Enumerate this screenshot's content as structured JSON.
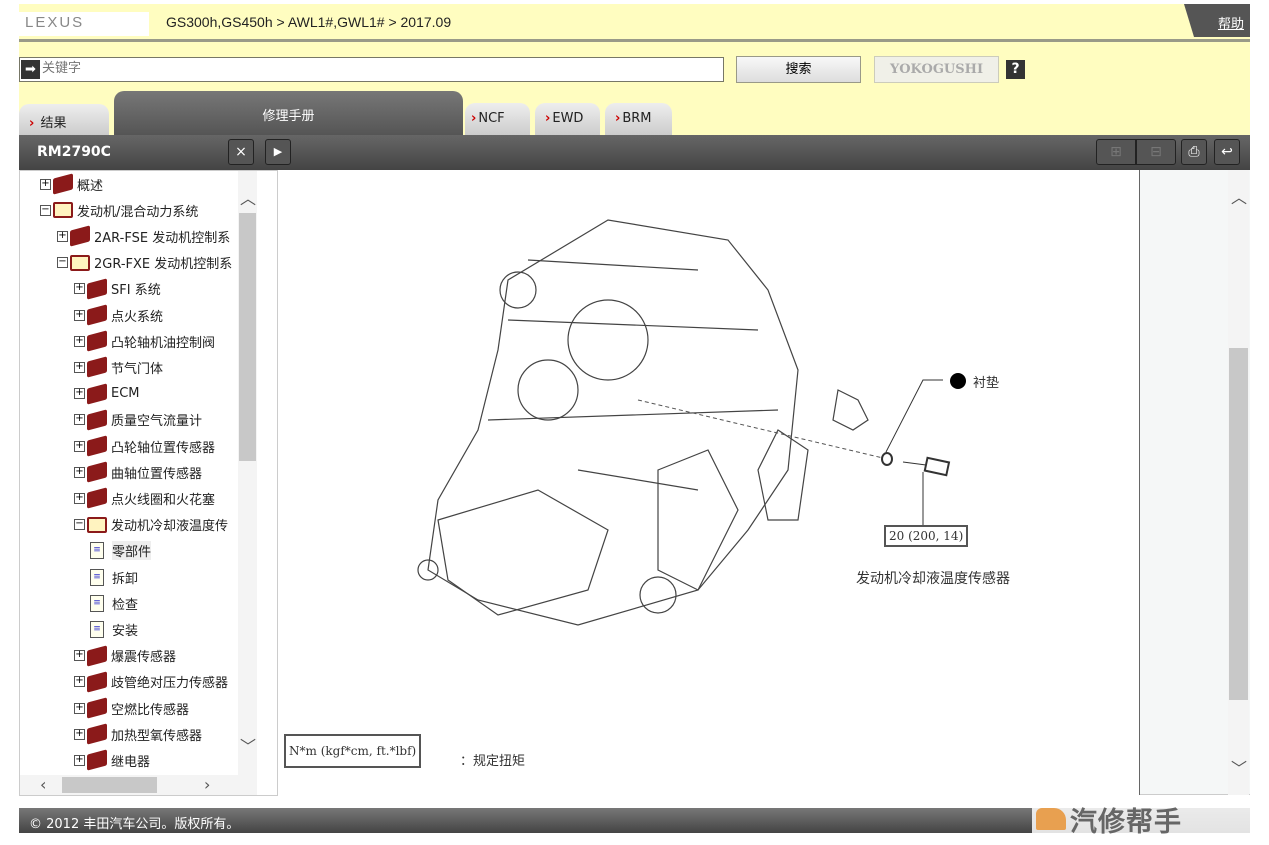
{
  "header": {
    "logo": "LEXUS",
    "breadcrumb": "GS300h,GS450h > AWL1#,GWL1# > 2017.09",
    "help": "帮助"
  },
  "search": {
    "placeholder": "关键字",
    "value": "",
    "search_btn": "搜索",
    "yokogushi_btn": "YOKOGUSHI",
    "help_icon": "?"
  },
  "tabs": [
    {
      "label": "结果"
    },
    {
      "label": "修理手册",
      "active": true
    },
    {
      "label": "NCF"
    },
    {
      "label": "EWD"
    },
    {
      "label": "BRM"
    }
  ],
  "toolbar": {
    "doc_id": "RM2790C",
    "close": "×",
    "expand": "▶",
    "zoom_in": "⊞",
    "zoom_out": "⊟",
    "print": "print-icon",
    "back": "back-icon"
  },
  "tree": [
    {
      "label": "概述",
      "level": 0,
      "type": "closed"
    },
    {
      "label": "发动机/混合动力系统",
      "level": 0,
      "type": "open"
    },
    {
      "label": "2AR-FSE 发动机控制系",
      "level": 1,
      "type": "closed"
    },
    {
      "label": "2GR-FXE 发动机控制系",
      "level": 1,
      "type": "open"
    },
    {
      "label": "SFI 系统",
      "level": 2,
      "type": "closed"
    },
    {
      "label": "点火系统",
      "level": 2,
      "type": "closed"
    },
    {
      "label": "凸轮轴机油控制阀",
      "level": 2,
      "type": "closed"
    },
    {
      "label": "节气门体",
      "level": 2,
      "type": "closed"
    },
    {
      "label": "ECM",
      "level": 2,
      "type": "closed"
    },
    {
      "label": "质量空气流量计",
      "level": 2,
      "type": "closed"
    },
    {
      "label": "凸轮轴位置传感器",
      "level": 2,
      "type": "closed"
    },
    {
      "label": "曲轴位置传感器",
      "level": 2,
      "type": "closed"
    },
    {
      "label": "点火线圈和火花塞",
      "level": 2,
      "type": "closed"
    },
    {
      "label": "发动机冷却液温度传",
      "level": 2,
      "type": "open"
    },
    {
      "label": "零部件",
      "level": 3,
      "type": "page",
      "selected": true
    },
    {
      "label": "拆卸",
      "level": 3,
      "type": "page"
    },
    {
      "label": "检查",
      "level": 3,
      "type": "page"
    },
    {
      "label": "安装",
      "level": 3,
      "type": "page"
    },
    {
      "label": "爆震传感器",
      "level": 2,
      "type": "closed"
    },
    {
      "label": "歧管绝对压力传感器",
      "level": 2,
      "type": "closed"
    },
    {
      "label": "空燃比传感器",
      "level": 2,
      "type": "closed"
    },
    {
      "label": "加热型氧传感器",
      "level": 2,
      "type": "closed"
    },
    {
      "label": "继电器",
      "level": 2,
      "type": "closed"
    }
  ],
  "figure": {
    "gasket_label": "衬垫",
    "torque": "20 (200, 14)",
    "part_name": "发动机冷却液温度传感器",
    "legend_box": "N*m (kgf*cm, ft.*lbf)",
    "legend_text": "：规定扭矩"
  },
  "footer": {
    "copyright": "© 2012 丰田汽车公司。版权所有。",
    "watermark": "汽修帮手"
  }
}
